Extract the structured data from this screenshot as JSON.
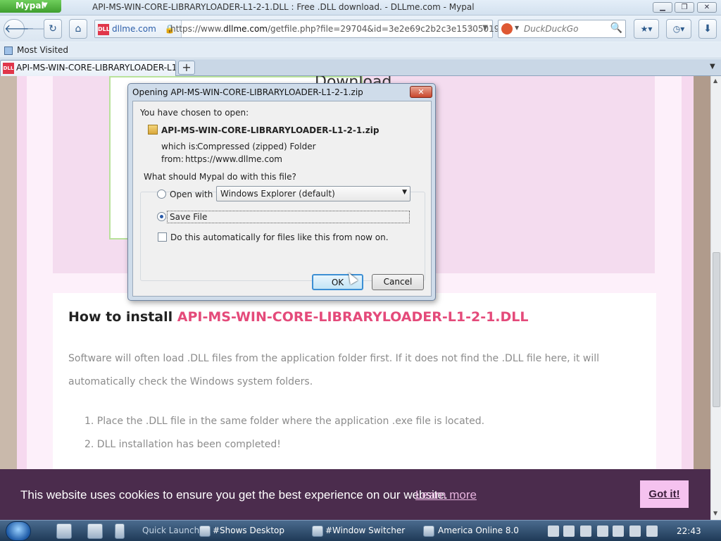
{
  "browser": {
    "app_name": "Mypal",
    "window_title": "API-MS-WIN-CORE-LIBRARYLOADER-L1-2-1.DLL : Free .DLL download. - DLLme.com - Mypal",
    "site_identity": "dllme.com",
    "url_prefix": "https://www.",
    "url_domain": "dllme.com",
    "url_path": "/getfile.php?file=29704&id=3e2e69c2b2c3e1530501934",
    "search_placeholder": "DuckDuckGo",
    "bookmark": "Most Visited",
    "tab_title": "API-MS-WIN-CORE-LIBRARYLOADER-L1...",
    "favicon_text": "DLL",
    "new_tab": "+"
  },
  "page": {
    "download_heading_fragment": "Download",
    "how_to_prefix": "How to install ",
    "how_to_dll": "API-MS-WIN-CORE-LIBRARYLOADER-L1-2-1.DLL",
    "paragraph": "Software will often load .DLL files from the application folder first. If it does not find the .DLL file here, it will automatically check the Windows system folders.",
    "steps": [
      "1. Place the .DLL file in the same folder where the application .exe file is located.",
      "2. DLL installation has been completed!"
    ]
  },
  "cookie": {
    "message": "This website uses cookies to ensure you get the best experience on our website.",
    "learn_more": "Learn more",
    "accept": "Got it!"
  },
  "dialog": {
    "title": "Opening API-MS-WIN-CORE-LIBRARYLOADER-L1-2-1.zip",
    "chosen": "You have chosen to open:",
    "filename": "API-MS-WIN-CORE-LIBRARYLOADER-L1-2-1.zip",
    "which_is_label": "which is:",
    "which_is_value": "Compressed (zipped) Folder",
    "from_label": "from:",
    "from_value": "https://www.dllme.com",
    "question": "What should Mypal do with this file?",
    "open_with_label": "Open with",
    "open_with_value": "Windows Explorer (default)",
    "save_file_label": "Save File",
    "auto_label": "Do this automatically for files like this from now on.",
    "ok": "OK",
    "cancel": "Cancel",
    "selected_option": "Save File",
    "auto_checked": false
  },
  "taskbar": {
    "quick_launch": "Quick Launch",
    "items": [
      "#Shows Desktop",
      "#Window Switcher",
      "America Online 8.0"
    ],
    "clock": "22:43"
  }
}
